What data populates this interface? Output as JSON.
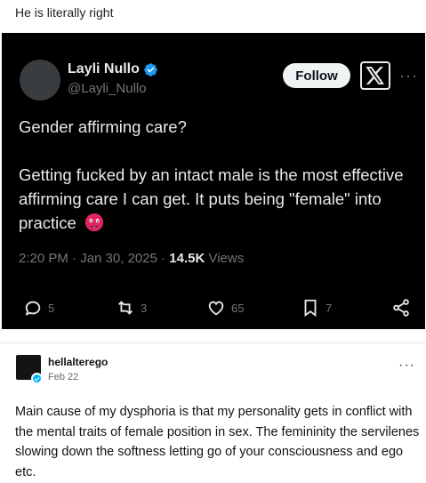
{
  "post": {
    "caption": "He is literally right"
  },
  "embed": {
    "author_name": "Layli Nullo",
    "author_handle": "@Layli_Nullo",
    "follow_label": "Follow",
    "text_line1": "Gender affirming care?",
    "text_body": "Getting fucked by an intact male is the most effective affirming care I can get. It puts being \"female\" into practice",
    "timestamp": "2:20 PM · Jan 30, 2025 · ",
    "views_count": "14.5K",
    "views_label": " Views",
    "actions": {
      "replies": "5",
      "reposts": "3",
      "likes": "65",
      "bookmarks": "7"
    },
    "colors": {
      "background": "#000000",
      "text": "#e7e9ea",
      "muted": "#71767b",
      "verified": "#1d9bf0",
      "emoji": "#e0245e"
    }
  },
  "reply": {
    "username": "hellalterego",
    "date": "Feb 22",
    "text": "Main cause of my dysphoria is that my personality gets in conflict with the mental traits of female position in sex. The femininity the servilenes slowing down the softness letting go of your consciousness and ego etc."
  },
  "icons": [
    "verified-badge-icon",
    "x-logo-icon",
    "more-options-icon",
    "reply-icon",
    "repost-icon",
    "like-icon",
    "bookmark-icon",
    "share-icon",
    "emoji-hot-face-icon"
  ]
}
